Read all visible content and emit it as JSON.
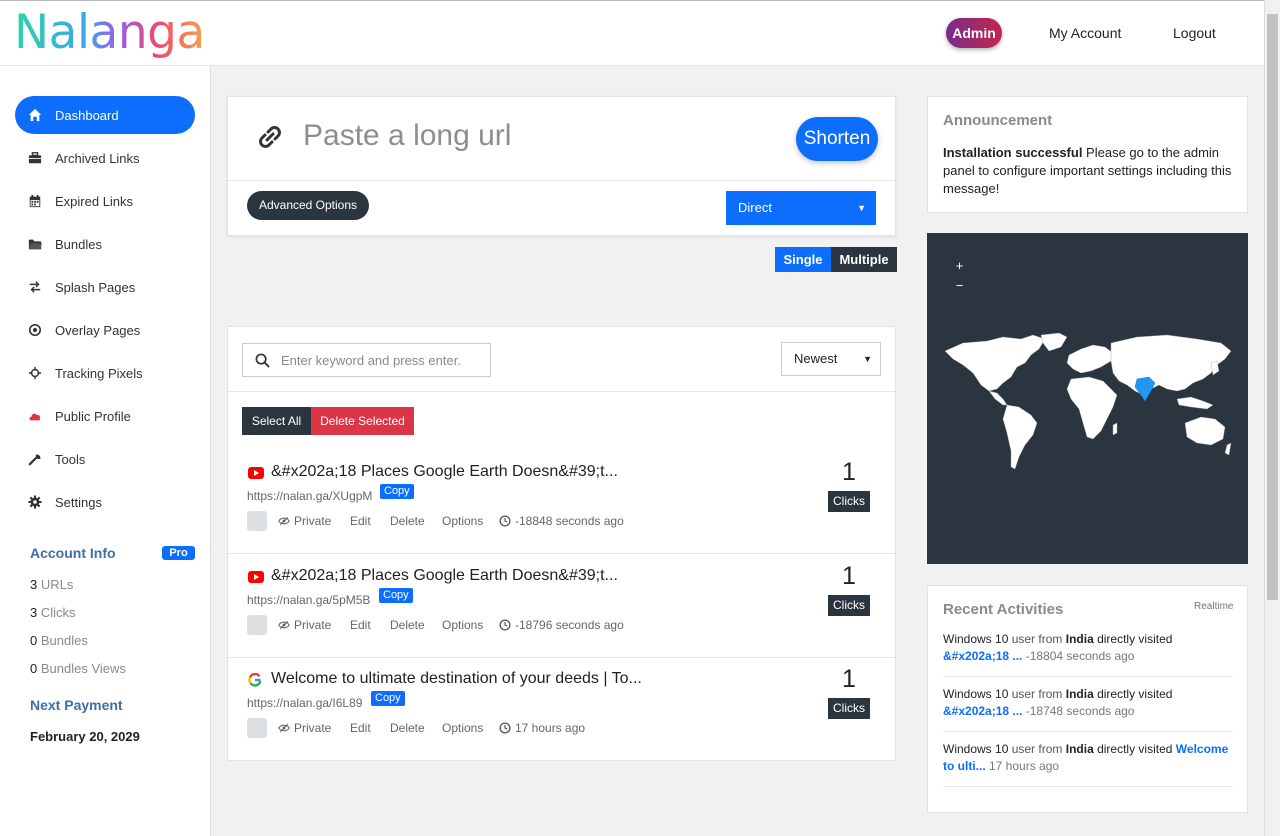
{
  "header": {
    "logo": "Nalanga",
    "admin_label": "Admin",
    "my_account_label": "My Account",
    "logout_label": "Logout"
  },
  "sidebar": {
    "items": [
      {
        "label": "Dashboard",
        "icon": "home-icon"
      },
      {
        "label": "Archived Links",
        "icon": "briefcase-icon"
      },
      {
        "label": "Expired Links",
        "icon": "calendar-icon"
      },
      {
        "label": "Bundles",
        "icon": "folder-icon"
      },
      {
        "label": "Splash Pages",
        "icon": "exchange-icon"
      },
      {
        "label": "Overlay Pages",
        "icon": "target-icon"
      },
      {
        "label": "Tracking Pixels",
        "icon": "crosshair-icon"
      },
      {
        "label": "Public Profile",
        "icon": "cloud-icon"
      },
      {
        "label": "Tools",
        "icon": "wrench-icon"
      },
      {
        "label": "Settings",
        "icon": "gear-icon"
      }
    ],
    "account_info_title": "Account Info",
    "pro_badge": "Pro",
    "stats": [
      {
        "count": "3",
        "label": "URLs"
      },
      {
        "count": "3",
        "label": "Clicks"
      },
      {
        "count": "0",
        "label": "Bundles"
      },
      {
        "count": "0",
        "label": "Bundles Views"
      }
    ],
    "next_payment_title": "Next Payment",
    "next_payment_date": "February 20, 2029"
  },
  "shortener": {
    "placeholder": "Paste a long url",
    "shorten_label": "Shorten",
    "advanced_label": "Advanced Options",
    "redirect_type": "Direct",
    "single_label": "Single",
    "multiple_label": "Multiple"
  },
  "links": {
    "search_placeholder": "Enter keyword and press enter.",
    "sort_value": "Newest",
    "select_all_label": "Select All",
    "delete_selected_label": "Delete Selected",
    "rows": [
      {
        "favicon": "youtube-icon",
        "title": "&#x202a;18 Places Google Earth Doesn&#39;t...",
        "short_url": "https://nalan.ga/XUgpM",
        "copy": "Copy",
        "private": "Private",
        "edit": "Edit",
        "delete": "Delete",
        "options": "Options",
        "time": "-18848 seconds ago",
        "clicks": "1",
        "clicks_label": "Clicks"
      },
      {
        "favicon": "youtube-icon",
        "title": "&#x202a;18 Places Google Earth Doesn&#39;t...",
        "short_url": "https://nalan.ga/5pM5B",
        "copy": "Copy",
        "private": "Private",
        "edit": "Edit",
        "delete": "Delete",
        "options": "Options",
        "time": "-18796 seconds ago",
        "clicks": "1",
        "clicks_label": "Clicks"
      },
      {
        "favicon": "google-icon",
        "title": "Welcome to ultimate destination of your deeds | To...",
        "short_url": "https://nalan.ga/I6L89",
        "copy": "Copy",
        "private": "Private",
        "edit": "Edit",
        "delete": "Delete",
        "options": "Options",
        "time": "17 hours ago",
        "clicks": "1",
        "clicks_label": "Clicks"
      }
    ]
  },
  "announcement": {
    "title": "Announcement",
    "bold": "Installation successful",
    "text": " Please go to the admin panel to configure important settings including this message!"
  },
  "map": {
    "zoom_in": "+",
    "zoom_out": "−",
    "highlight_country": "India",
    "highlight_color": "#2196f3"
  },
  "activities": {
    "title": "Recent Activities",
    "realtime_label": "Realtime",
    "items": [
      {
        "user": "Windows 10",
        "mid1": " user from ",
        "country": "India",
        "mid2": " directly visited ",
        "link": "&#x202a;18 ...",
        "time": " -18804 seconds ago"
      },
      {
        "user": "Windows 10",
        "mid1": " user from ",
        "country": "India",
        "mid2": " directly visited ",
        "link": "&#x202a;18 ...",
        "time": " -18748 seconds ago"
      },
      {
        "user": "Windows 10",
        "mid1": " user from ",
        "country": "India",
        "mid2": " directly visited ",
        "link": "Welcome to ulti...",
        "time": " 17 hours ago"
      }
    ]
  },
  "colors": {
    "primary": "#0d6efd",
    "dark": "#2b3540",
    "danger": "#dc3545"
  }
}
